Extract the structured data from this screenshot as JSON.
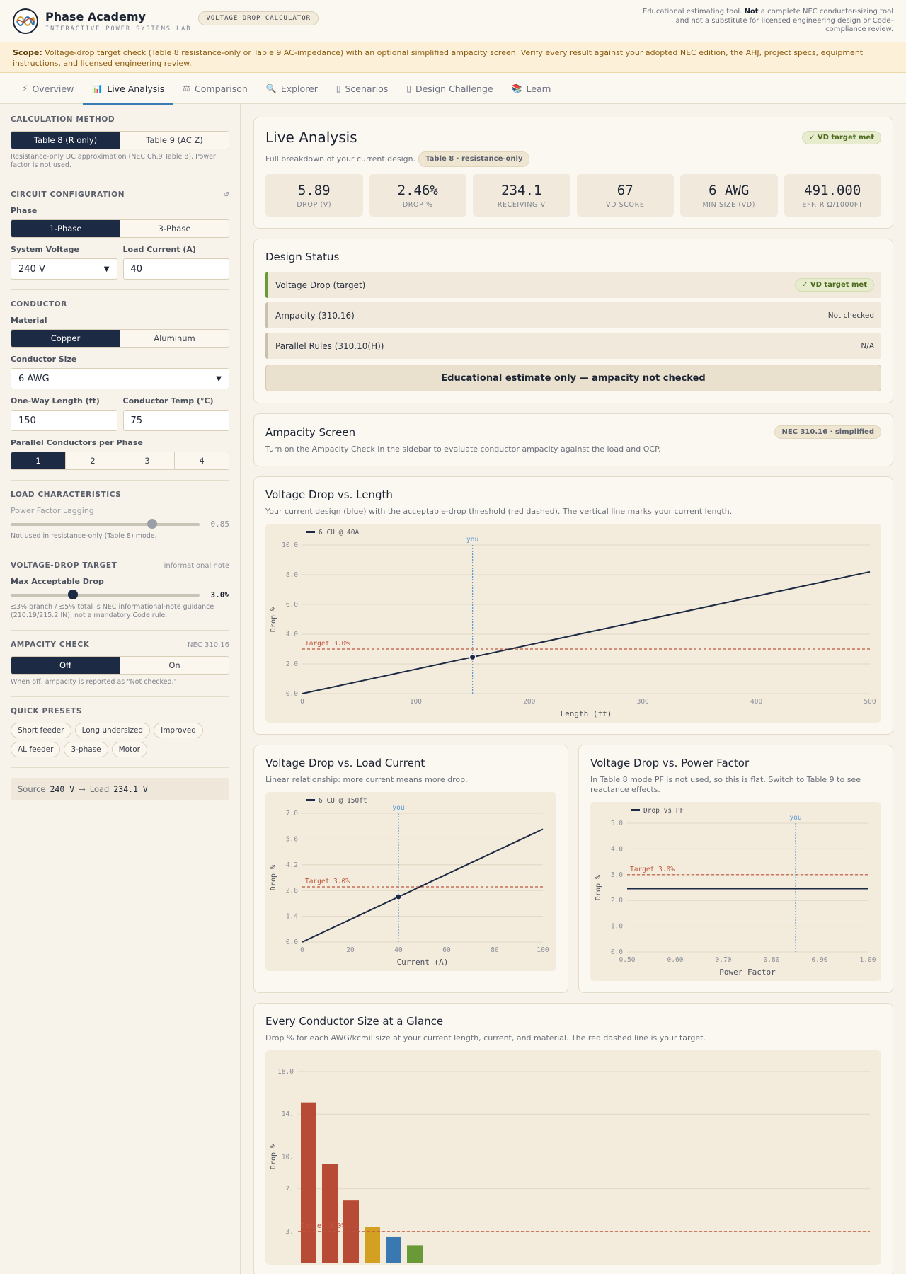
{
  "header": {
    "brand_title": "Phase Academy",
    "brand_sub": "INTERACTIVE POWER SYSTEMS LAB",
    "tool_badge": "VOLTAGE DROP CALCULATOR",
    "disclaimer_pre": "Educational estimating tool. ",
    "disclaimer_bold": "Not",
    "disclaimer_post": " a complete NEC conductor-sizing tool and not a substitute for licensed engineering design or Code-compliance review."
  },
  "scope": {
    "label": "Scope:",
    "text": " Voltage-drop target check (Table 8 resistance-only or Table 9 AC-impedance) with an optional simplified ampacity screen. Verify every result against your adopted NEC edition, the AHJ, project specs, equipment instructions, and licensed engineering review."
  },
  "tabs": [
    {
      "label": "Overview",
      "icon": "⚡"
    },
    {
      "label": "Live Analysis",
      "icon": "📊"
    },
    {
      "label": "Comparison",
      "icon": "⚖"
    },
    {
      "label": "Explorer",
      "icon": "🔍"
    },
    {
      "label": "Scenarios",
      "icon": "▯"
    },
    {
      "label": "Design Challenge",
      "icon": "▯"
    },
    {
      "label": "Learn",
      "icon": "📚"
    }
  ],
  "sidebar": {
    "calc_method": {
      "title": "CALCULATION METHOD",
      "options": [
        "Table 8 (R only)",
        "Table 9 (AC Z)"
      ],
      "help": "Resistance-only DC approximation (NEC Ch.9 Table 8). Power factor is not used."
    },
    "circuit": {
      "title": "CIRCUIT CONFIGURATION",
      "reset_icon": "↺",
      "phase_label": "Phase",
      "phase_options": [
        "1-Phase",
        "3-Phase"
      ],
      "voltage_label": "System Voltage",
      "voltage_value": "240 V",
      "current_label": "Load Current (A)",
      "current_value": "40"
    },
    "conductor": {
      "title": "CONDUCTOR",
      "material_label": "Material",
      "material_options": [
        "Copper",
        "Aluminum"
      ],
      "size_label": "Conductor Size",
      "size_value": "6 AWG",
      "length_label": "One-Way Length (ft)",
      "length_value": "150",
      "temp_label": "Conductor Temp (°C)",
      "temp_value": "75",
      "parallel_label": "Parallel Conductors per Phase",
      "parallel_options": [
        "1",
        "2",
        "3",
        "4"
      ]
    },
    "load": {
      "title": "LOAD CHARACTERISTICS",
      "pf_label": "Power Factor Lagging",
      "pf_value": "0.85",
      "pf_fraction": 0.75,
      "help": "Not used in resistance-only (Table 8) mode."
    },
    "target": {
      "title": "VOLTAGE-DROP TARGET",
      "note": "informational note",
      "label": "Max Acceptable Drop",
      "value": "3.0%",
      "fraction": 0.33,
      "help": "≤3% branch / ≤5% total is NEC informational-note guidance (210.19/215.2 IN), not a mandatory Code rule."
    },
    "ampacity": {
      "title": "AMPACITY CHECK",
      "note": "NEC 310.16",
      "options": [
        "Off",
        "On"
      ],
      "help": "When off, ampacity is reported as \"Not checked.\""
    },
    "presets": {
      "title": "QUICK PRESETS",
      "items": [
        "Short feeder",
        "Long undersized",
        "Improved",
        "AL feeder",
        "3-phase",
        "Motor"
      ]
    },
    "source_bar": {
      "source_label": "Source",
      "source_value": "240 V",
      "arrow": "→",
      "load_label": "Load",
      "load_value": "234.1 V"
    }
  },
  "live": {
    "title": "Live Analysis",
    "badge": "✓ VD target met",
    "subtitle": "Full breakdown of your current design.",
    "method_pill": "Table 8 · resistance-only",
    "metrics": [
      {
        "value": "5.89",
        "label": "DROP (V)"
      },
      {
        "value": "2.46%",
        "label": "DROP %"
      },
      {
        "value": "234.1",
        "label": "RECEIVING V"
      },
      {
        "value": "67",
        "label": "VD SCORE"
      },
      {
        "value": "6 AWG",
        "label": "MIN SIZE (VD)"
      },
      {
        "value": "491.000",
        "label": "EFF. R Ω/1000FT"
      }
    ]
  },
  "design_status": {
    "title": "Design Status",
    "rows": [
      {
        "label": "Voltage Drop (target)",
        "status": "✓ VD target met"
      },
      {
        "label": "Ampacity (310.16)",
        "status": "Not checked"
      },
      {
        "label": "Parallel Rules (310.10(H))",
        "status": "N/A"
      }
    ],
    "banner": "Educational estimate only — ampacity not checked"
  },
  "ampacity_screen": {
    "title": "Ampacity Screen",
    "badge": "NEC 310.16 · simplified",
    "text": "Turn on the Ampacity Check in the sidebar to evaluate conductor ampacity against the load and OCP."
  },
  "chart_data": [
    {
      "type": "line",
      "title": "Voltage Drop vs. Length",
      "subtitle": "Your current design (blue) with the acceptable-drop threshold (red dashed). The vertical line marks your current length.",
      "series": [
        {
          "name": "6 CU @ 40A",
          "x": [
            0,
            500
          ],
          "y": [
            0,
            8.2
          ]
        }
      ],
      "marker": {
        "x": 150,
        "y": 2.46,
        "label": "you"
      },
      "threshold": {
        "y": 3.0,
        "label": "Target 3.0%"
      },
      "xlabel": "Length (ft)",
      "ylabel": "Drop %",
      "xlim": [
        0,
        500
      ],
      "ylim": [
        0,
        10
      ],
      "xticks": [
        0,
        100,
        200,
        300,
        400,
        500
      ],
      "xtick_labels": [
        "0",
        "100",
        "200",
        "300",
        "400",
        "500"
      ],
      "yticks": [
        0,
        2,
        4,
        6,
        8,
        10
      ],
      "ytick_labels": [
        "0.0",
        "2.0",
        "4.0",
        "6.0",
        "8.0",
        "10.0"
      ],
      "grid": true,
      "legend": "top-left"
    },
    {
      "type": "line",
      "title": "Voltage Drop vs. Load Current",
      "subtitle": "Linear relationship: more current means more drop.",
      "series": [
        {
          "name": "6 CU @ 150ft",
          "x": [
            0,
            100
          ],
          "y": [
            0,
            6.14
          ]
        }
      ],
      "marker": {
        "x": 40,
        "y": 2.46,
        "label": "you"
      },
      "threshold": {
        "y": 3.0,
        "label": "Target 3.0%"
      },
      "xlabel": "Current (A)",
      "ylabel": "Drop %",
      "xlim": [
        0,
        100
      ],
      "ylim": [
        0,
        7
      ],
      "xticks": [
        0,
        20,
        40,
        60,
        80,
        100
      ],
      "xtick_labels": [
        "0",
        "20",
        "40",
        "60",
        "80",
        "100"
      ],
      "yticks": [
        0,
        1.4,
        2.8,
        4.2,
        5.6,
        7.0
      ],
      "ytick_labels": [
        "0.0",
        "1.4",
        "2.8",
        "4.2",
        "5.6",
        "7.0"
      ],
      "grid": true,
      "legend": "top-left"
    },
    {
      "type": "line",
      "title": "Voltage Drop vs. Power Factor",
      "subtitle": "In Table 8 mode PF is not used, so this is flat. Switch to Table 9 to see reactance effects.",
      "series": [
        {
          "name": "Drop vs PF",
          "x": [
            0.5,
            1.0
          ],
          "y": [
            2.46,
            2.46
          ]
        }
      ],
      "marker": {
        "x": 0.85,
        "label": "you"
      },
      "threshold": {
        "y": 3.0,
        "label": "Target 3.0%"
      },
      "xlabel": "Power Factor",
      "ylabel": "Drop %",
      "xlim": [
        0.5,
        1.0
      ],
      "ylim": [
        0,
        5
      ],
      "xticks": [
        0.5,
        0.6,
        0.7,
        0.8,
        0.9,
        1.0
      ],
      "xtick_labels": [
        "0.50",
        "0.60",
        "0.70",
        "0.80",
        "0.90",
        "1.00"
      ],
      "yticks": [
        0,
        1,
        2,
        3,
        4,
        5
      ],
      "ytick_labels": [
        "0.0",
        "1.0",
        "2.0",
        "3.0",
        "4.0",
        "5.0"
      ],
      "grid": true,
      "legend": "top-left"
    },
    {
      "type": "bar",
      "title": "Every Conductor Size at a Glance",
      "subtitle": "Drop % for each AWG/kcmil size at your current length, current, and material. The red dashed line is your target.",
      "values": [
        15.1,
        9.3,
        5.9,
        3.4,
        2.46,
        1.7
      ],
      "colors": [
        "#b84b36",
        "#b84b36",
        "#b84b36",
        "#d4a021",
        "#3978b0",
        "#6a9a38"
      ],
      "threshold": {
        "y": 3.0,
        "label": "Target 3.0%"
      },
      "ylabel": "Drop %",
      "ylim": [
        0,
        18
      ],
      "yticks": [
        3.0,
        7.0,
        10.0,
        14.0,
        18.0
      ],
      "ytick_labels": [
        "3.",
        "7.",
        "10.",
        "14.",
        "18.0"
      ],
      "grid": true
    }
  ]
}
